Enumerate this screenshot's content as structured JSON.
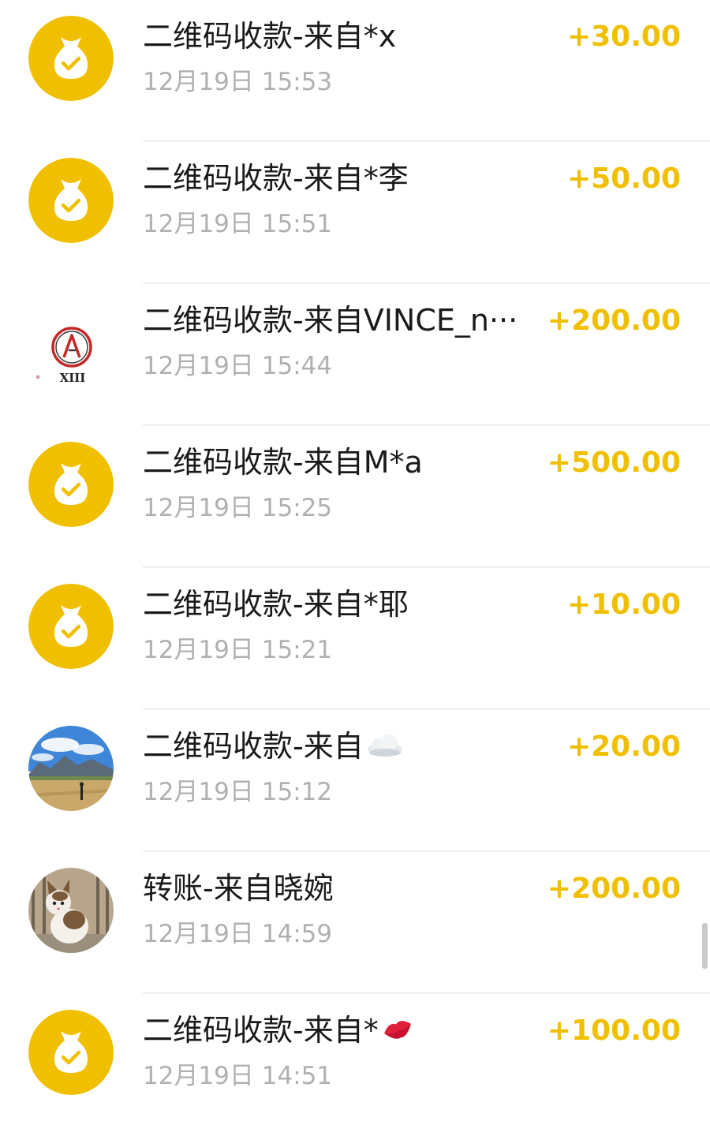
{
  "colors": {
    "accent": "#f0c000",
    "title": "#1a1a1a",
    "time": "#b0b0b0",
    "divider": "#ededed"
  },
  "transactions": [
    {
      "avatar": "money-bag-icon",
      "title": "二维码收款-来自*x",
      "time": "12月19日 15:53",
      "amount": "+30.00"
    },
    {
      "avatar": "money-bag-icon",
      "title": "二维码收款-来自*李",
      "time": "12月19日 15:51",
      "amount": "+50.00"
    },
    {
      "avatar": "linkin-park-logo",
      "logo_text": "XIII",
      "title": "二维码收款-来自VINCE_n···",
      "time": "12月19日 15:44",
      "amount": "+200.00"
    },
    {
      "avatar": "money-bag-icon",
      "title": "二维码收款-来自M*a",
      "time": "12月19日 15:25",
      "amount": "+500.00"
    },
    {
      "avatar": "money-bag-icon",
      "title": "二维码收款-来自*耶",
      "time": "12月19日 15:21",
      "amount": "+10.00"
    },
    {
      "avatar": "landscape-photo",
      "title": "二维码收款-来自",
      "title_suffix_icon": "cloud-emoji",
      "time": "12月19日 15:12",
      "amount": "+20.00"
    },
    {
      "avatar": "cat-photo",
      "title": "转账-来自晓婉",
      "time": "12月19日 14:59",
      "amount": "+200.00"
    },
    {
      "avatar": "money-bag-icon",
      "title": "二维码收款-来自*",
      "title_suffix_icon": "kiss-lips-emoji",
      "time": "12月19日 14:51",
      "amount": "+100.00"
    }
  ]
}
